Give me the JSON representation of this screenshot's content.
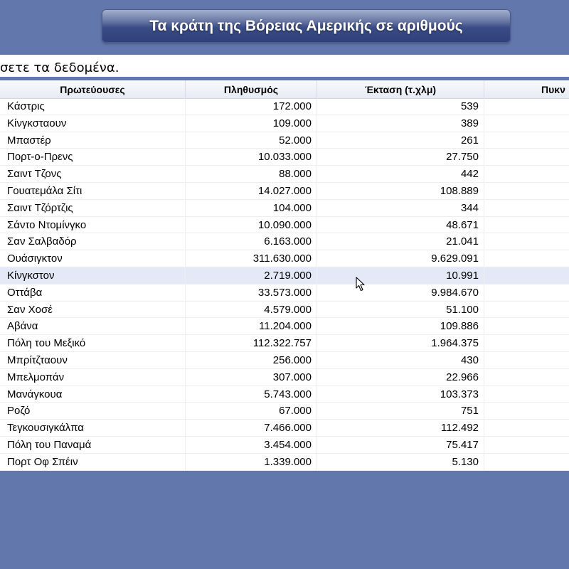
{
  "title": "Τα κράτη της Βόρειας Αμερικής σε αριθμούς",
  "instruction": "σετε τα δεδομένα.",
  "columns": [
    "Πρωτεύουσες",
    "Πληθυσμός",
    "Έκταση (τ.χλμ)",
    "Πυκν"
  ],
  "highlighted_row": 10,
  "rows": [
    [
      "Κάστρις",
      "172.000",
      "539"
    ],
    [
      "Κίνγκσταουν",
      "109.000",
      "389"
    ],
    [
      "Μπαστέρ",
      "52.000",
      "261"
    ],
    [
      "Πορτ-ο-Πρενς",
      "10.033.000",
      "27.750"
    ],
    [
      "Σαιντ Τζονς",
      "88.000",
      "442"
    ],
    [
      "Γουατεμάλα Σίτι",
      "14.027.000",
      "108.889"
    ],
    [
      "Σαιντ Τζόρτζις",
      "104.000",
      "344"
    ],
    [
      "Σάντο Ντομίνγκο",
      "10.090.000",
      "48.671"
    ],
    [
      "Σαν Σαλβαδόρ",
      "6.163.000",
      "21.041"
    ],
    [
      "Ουάσιγκτον",
      "311.630.000",
      "9.629.091"
    ],
    [
      "Κίνγκστον",
      "2.719.000",
      "10.991"
    ],
    [
      "Οττάβα",
      "33.573.000",
      "9.984.670"
    ],
    [
      "Σαν Χοσέ",
      "4.579.000",
      "51.100"
    ],
    [
      "Αβάνα",
      "11.204.000",
      "109.886"
    ],
    [
      "Πόλη του Μεξικό",
      "112.322.757",
      "1.964.375"
    ],
    [
      "Μπρίτζταουν",
      "256.000",
      "430"
    ],
    [
      "Μπελμοπάν",
      "307.000",
      "22.966"
    ],
    [
      "Μανάγκουα",
      "5.743.000",
      "103.373"
    ],
    [
      "Ροζό",
      "67.000",
      "751"
    ],
    [
      "Τεγκουσιγκάλπα",
      "7.466.000",
      "112.492"
    ],
    [
      "Πόλη του Παναμά",
      "3.454.000",
      "75.417"
    ],
    [
      "Πορτ Οφ Σπέιν",
      "1.339.000",
      "5.130"
    ]
  ],
  "icons": {
    "cursor": "mouse-pointer-icon"
  }
}
